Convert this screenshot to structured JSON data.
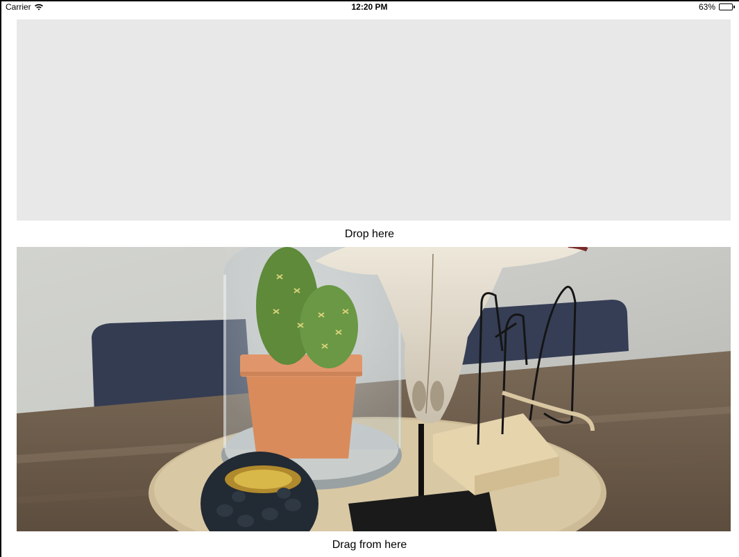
{
  "status_bar": {
    "carrier": "Carrier",
    "time": "12:20 PM",
    "battery_percent_label": "63%",
    "battery_level": 0.63,
    "icons": [
      "wifi-icon",
      "battery-icon"
    ]
  },
  "drop_zone": {
    "caption": "Drop here",
    "background_color": "#e8e8e8"
  },
  "drag_source": {
    "caption": "Drag from here",
    "image_icon": "photo-cactus-skull-tabletop"
  }
}
